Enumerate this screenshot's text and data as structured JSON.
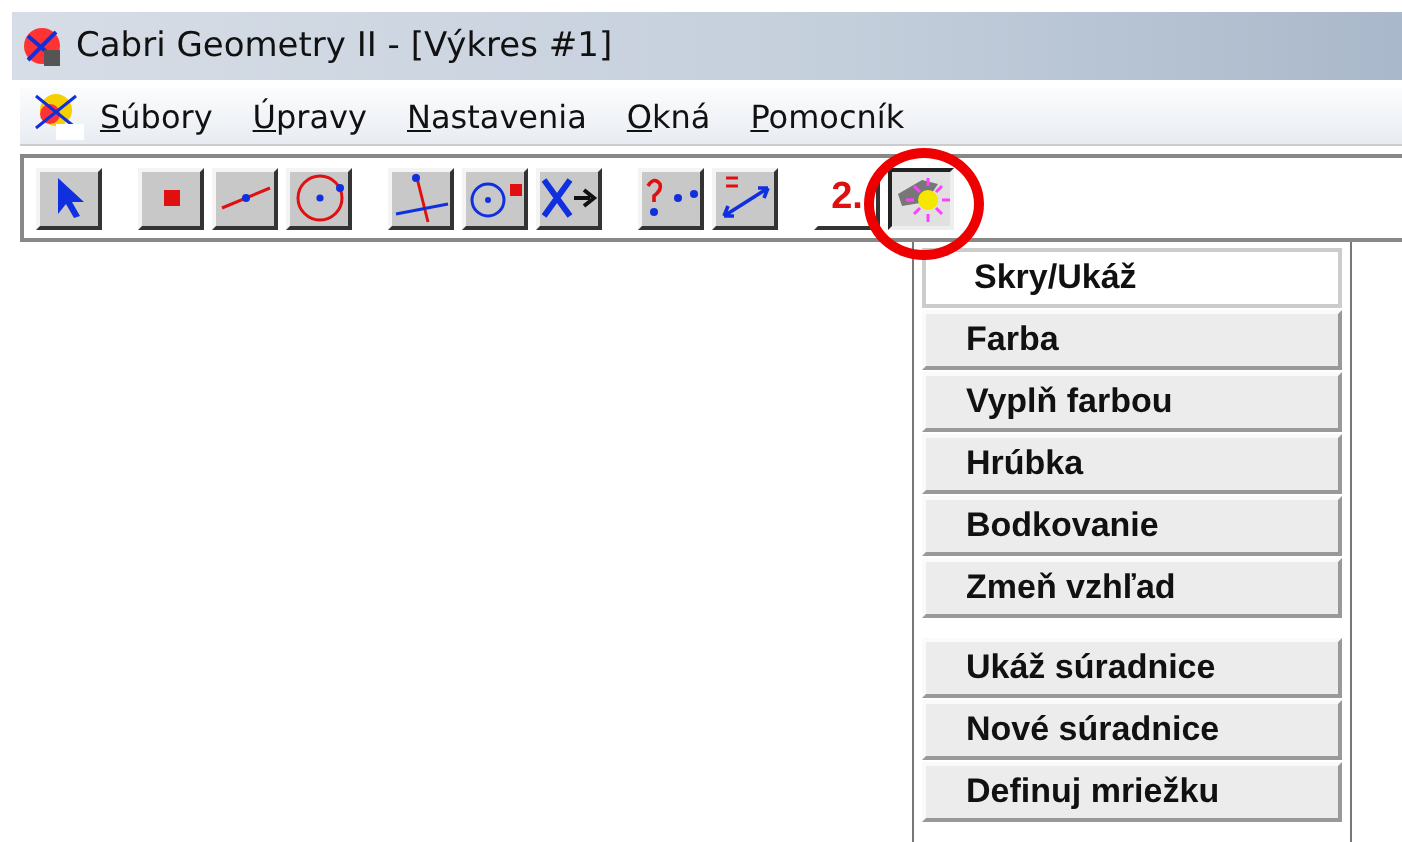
{
  "window": {
    "title": "Cabri Geometry II - [Výkres #1]"
  },
  "menu_bar": [
    {
      "label": "Súbory",
      "underlined_first": true
    },
    {
      "label": "Úpravy",
      "underlined_first": true
    },
    {
      "label": "Nastavenia",
      "underlined_first": true
    },
    {
      "label": "Okná",
      "underlined_first": true
    },
    {
      "label": "Pomocník",
      "underlined_first": true
    }
  ],
  "toolbar": [
    [
      {
        "kind": "arrow",
        "selected": false,
        "highlighted": false
      }
    ],
    [
      {
        "kind": "point",
        "selected": false,
        "highlighted": false
      },
      {
        "kind": "line",
        "selected": false,
        "highlighted": false
      },
      {
        "kind": "circle",
        "selected": false,
        "highlighted": false
      }
    ],
    [
      {
        "kind": "perpendicular",
        "selected": false,
        "highlighted": false
      },
      {
        "kind": "compass",
        "selected": false,
        "highlighted": false
      },
      {
        "kind": "transform",
        "selected": false,
        "highlighted": false
      }
    ],
    [
      {
        "kind": "check",
        "selected": false,
        "highlighted": false
      },
      {
        "kind": "measure",
        "selected": false,
        "highlighted": false
      }
    ],
    [
      {
        "kind": "text",
        "label": "2.",
        "selected": false,
        "highlighted": false
      },
      {
        "kind": "display",
        "selected": true,
        "highlighted": true
      }
    ]
  ],
  "dropdown": [
    [
      {
        "label": "Skry/Ukáž",
        "selected": true
      },
      {
        "label": "Farba",
        "selected": false
      },
      {
        "label": "Vyplň farbou",
        "selected": false
      },
      {
        "label": "Hrúbka",
        "selected": false
      },
      {
        "label": "Bodkovanie",
        "selected": false
      },
      {
        "label": "Zmeň vzhľad",
        "selected": false
      }
    ],
    [
      {
        "label": "Ukáž súradnice",
        "selected": false
      },
      {
        "label": "Nové súradnice",
        "selected": false
      },
      {
        "label": "Definuj mriežku",
        "selected": false
      }
    ]
  ]
}
